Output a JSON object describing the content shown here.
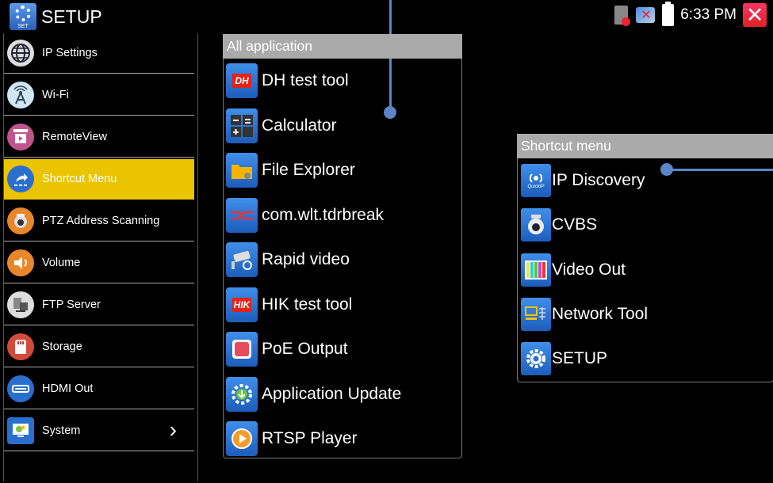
{
  "titlebar": {
    "title": "SETUP",
    "app_icon": "gear-icon",
    "app_icon_caption": "SET",
    "time": "6:33 PM",
    "close_icon": "close-icon"
  },
  "sidebar": {
    "items": [
      {
        "label": "IP Settings",
        "icon": "globe-icon",
        "active": false
      },
      {
        "label": "Wi-Fi",
        "icon": "wifi-tower-icon",
        "active": false
      },
      {
        "label": "RemoteView",
        "icon": "remoteview-icon",
        "active": false
      },
      {
        "label": "Shortcut Menu",
        "icon": "shortcut-icon",
        "active": true
      },
      {
        "label": "PTZ Address Scanning",
        "icon": "ptz-camera-icon",
        "active": false
      },
      {
        "label": "Volume",
        "icon": "speaker-icon",
        "active": false
      },
      {
        "label": "FTP Server",
        "icon": "ftp-icon",
        "active": false
      },
      {
        "label": "Storage",
        "icon": "sd-card-icon",
        "active": false
      },
      {
        "label": "HDMI Out",
        "icon": "hdmi-icon",
        "active": false
      },
      {
        "label": "System",
        "icon": "system-icon",
        "active": false,
        "chevron": "›"
      }
    ]
  },
  "all_application": {
    "header": "All application",
    "items": [
      {
        "label": "DH test tool",
        "icon": "dh-icon",
        "icon_text": "DH"
      },
      {
        "label": "Calculator",
        "icon": "calculator-icon"
      },
      {
        "label": "File Explorer",
        "icon": "folder-icon"
      },
      {
        "label": "com.wlt.tdrbreak",
        "icon": "tdr-icon"
      },
      {
        "label": "Rapid video",
        "icon": "camera-icon"
      },
      {
        "label": "HIK test tool",
        "icon": "hik-icon",
        "icon_text": "HIK"
      },
      {
        "label": "PoE Output",
        "icon": "poe-icon"
      },
      {
        "label": "Application Update",
        "icon": "update-icon"
      },
      {
        "label": "RTSP Player",
        "icon": "play-icon"
      }
    ]
  },
  "shortcut_menu": {
    "header": "Shortcut menu",
    "items": [
      {
        "label": "IP Discovery",
        "icon": "ip-discovery-icon",
        "icon_text": "QuickIP"
      },
      {
        "label": "CVBS",
        "icon": "dome-camera-icon"
      },
      {
        "label": "Video Out",
        "icon": "color-bars-icon"
      },
      {
        "label": "Network Tool",
        "icon": "network-tool-icon"
      },
      {
        "label": "SETUP",
        "icon": "gear-icon"
      }
    ]
  },
  "colors": {
    "accent_active": "#eac400",
    "panel_header": "#aaaaaa",
    "annotation": "#5b85c8",
    "close_red": "#e0223a"
  }
}
